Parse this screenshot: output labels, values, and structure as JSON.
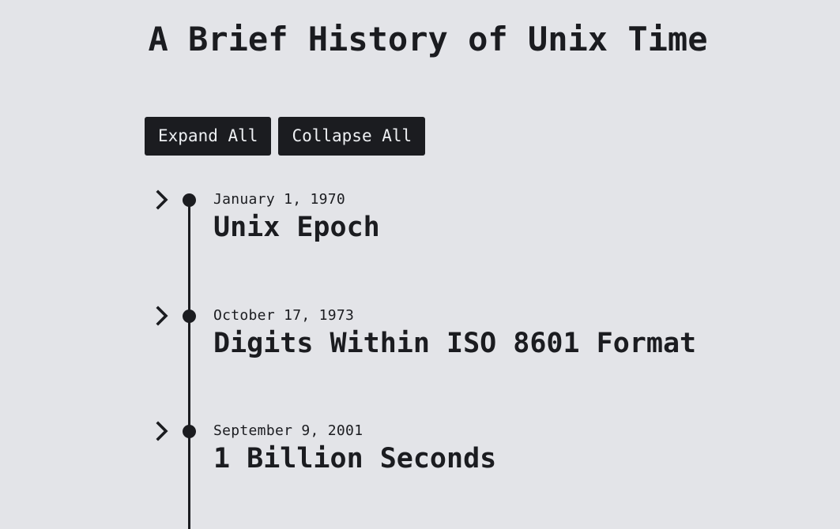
{
  "page": {
    "title": "A Brief History of Unix Time"
  },
  "toolbar": {
    "expand_label": "Expand All",
    "collapse_label": "Collapse All"
  },
  "events": [
    {
      "date": "January 1, 1970",
      "title": "Unix Epoch",
      "expanded": false
    },
    {
      "date": "October 17, 1973",
      "title": "Digits Within ISO 8601 Format",
      "expanded": false
    },
    {
      "date": "September 9, 2001",
      "title": "1 Billion Seconds",
      "expanded": false
    }
  ],
  "colors": {
    "background": "#e3e4e8",
    "ink": "#1b1c20",
    "button_text": "#eef0f3"
  },
  "icons": {
    "toggle": "chevron-right-icon",
    "marker": "timeline-dot"
  }
}
